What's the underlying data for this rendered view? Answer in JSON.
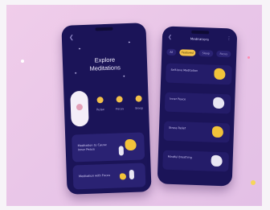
{
  "colors": {
    "background": "#f0cdea",
    "phone": "#1b1458",
    "card": "#2a2273",
    "accent_yellow": "#f2c04a",
    "accent_pink": "#e3a0b8"
  },
  "left_phone": {
    "back_icon": "chevron-left-icon",
    "title": "Explore\nMeditations",
    "categories": [
      {
        "icon": "lotus-icon",
        "label": "",
        "active": true
      },
      {
        "icon": "sun-icon",
        "label": "Relax"
      },
      {
        "icon": "sun-icon",
        "label": "Focus"
      },
      {
        "icon": "sun-icon",
        "label": "Sleep"
      }
    ],
    "cards": [
      {
        "title": "Meditation to Cause Inner Peace"
      },
      {
        "title": "Meditation with Focus"
      }
    ]
  },
  "right_phone": {
    "header": "Meditations",
    "back_icon": "chevron-left-icon",
    "menu_icon": "menu-icon",
    "pills": [
      {
        "label": "All"
      },
      {
        "label": "Featured",
        "active": true
      },
      {
        "label": "Sleep"
      },
      {
        "label": "Focus"
      }
    ],
    "rows": [
      {
        "title": "Self-love Meditation"
      },
      {
        "title": "Inner Peace"
      },
      {
        "title": "Stress Relief"
      },
      {
        "title": "Mindful Breathing"
      }
    ]
  }
}
